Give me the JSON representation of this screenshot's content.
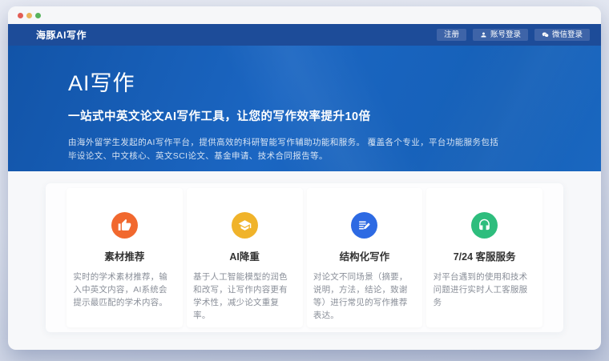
{
  "navbar": {
    "logo": "海豚AI写作",
    "register_label": "注册",
    "account_login_label": "账号登录",
    "wechat_login_label": "微信登录"
  },
  "hero": {
    "title": "AI写作",
    "subtitle": "一站式中英文论文AI写作工具，让您的写作效率提升10倍",
    "description_line1": "由海外留学生发起的AI写作平台，提供高效的科研智能写作辅助功能和服务。 覆盖各个专业，平台功能服务包括",
    "description_line2": "毕设论文、中文核心、英文SCI论文、基金申请、技术合同报告等。"
  },
  "features": [
    {
      "title": "素材推荐",
      "description": "实时的学术素材推荐，输入中英文内容，AI系统会提示最匹配的学术内容。",
      "icon": "thumbs-up-icon",
      "color": "#f1682e"
    },
    {
      "title": "AI降重",
      "description": "基于人工智能模型的润色和改写，让写作内容更有学术性，减少论文重复率。",
      "icon": "graduation-cap-icon",
      "color": "#f0b32a"
    },
    {
      "title": "结构化写作",
      "description": "对论文不同场景（摘要，说明，方法，结论，致谢等）进行常见的写作推荐表达。",
      "icon": "document-edit-icon",
      "color": "#2d6ae3"
    },
    {
      "title": "7/24 客服服务",
      "description": "对平台遇到的使用和技术问题进行实时人工客服服务",
      "icon": "headset-icon",
      "color": "#2ebd7d"
    }
  ],
  "colors": {
    "navbar_bg": "#1d4c99",
    "hero_bg": "#1b66c2",
    "nav_button_bg": "#3e64a8",
    "traffic_red": "#e25d55",
    "traffic_yellow": "#e9b45a",
    "traffic_green": "#57b35c",
    "page_bg_bottom": "#c3cbde"
  }
}
